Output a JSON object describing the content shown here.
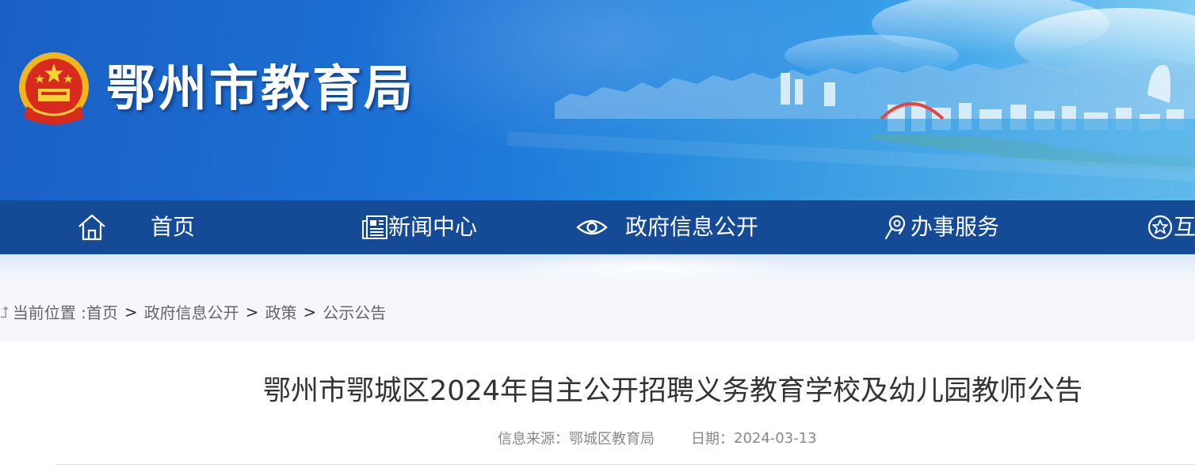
{
  "header": {
    "site_title": "鄂州市教育局",
    "emblem_icon": "national-emblem-icon"
  },
  "nav": {
    "items": [
      {
        "label": "首页",
        "icon": "home-icon"
      },
      {
        "label": "新闻中心",
        "icon": "newspaper-icon"
      },
      {
        "label": "政府信息公开",
        "icon": "eye-icon"
      },
      {
        "label": "办事服务",
        "icon": "service-icon"
      },
      {
        "label": "互",
        "icon": "star-icon"
      }
    ]
  },
  "breadcrumb": {
    "prefix": "当前位置 :",
    "items": [
      "首页",
      "政府信息公开",
      "政策",
      "公示公告"
    ],
    "separator": ">"
  },
  "article": {
    "title": "鄂州市鄂城区2024年自主公开招聘义务教育学校及幼儿园教师公告",
    "source_label": "信息来源：",
    "source_value": "鄂城区教育局",
    "date_label": "日期：",
    "date_value": "2024-03-13"
  },
  "colors": {
    "nav_bg": "#154a96",
    "banner_start": "#1a5fc4",
    "banner_end": "#8cd2f3",
    "breadcrumb_bg": "#f5f7fb",
    "title_text": "#333333"
  }
}
